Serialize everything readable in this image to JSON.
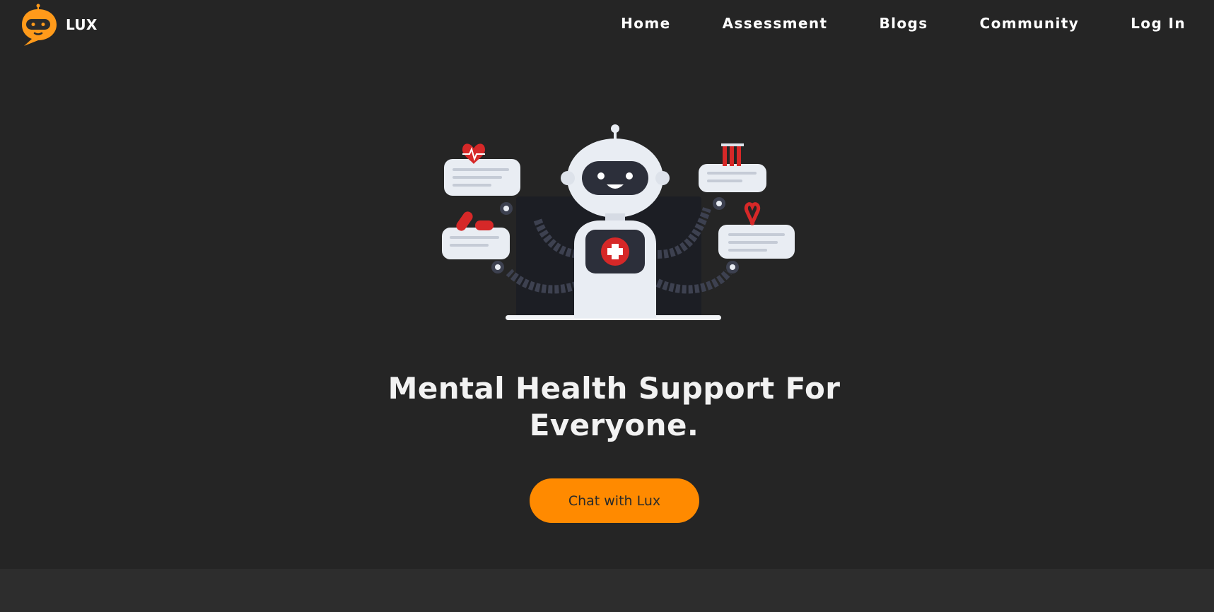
{
  "brand": {
    "name": "LUX",
    "logo_icon": "robot-chat-bubble-icon",
    "accent": "#ff8a00"
  },
  "nav": {
    "items": [
      {
        "label": "Home"
      },
      {
        "label": "Assessment"
      },
      {
        "label": "Blogs"
      },
      {
        "label": "Community"
      },
      {
        "label": "Log In"
      }
    ]
  },
  "hero": {
    "illustration": "medical-robot-icon",
    "title_line1": "Mental Health Support For",
    "title_line2": "Everyone.",
    "cta_label": "Chat with Lux"
  },
  "colors": {
    "background": "#252525",
    "footer_band": "#2d2d2d",
    "cta": "#ff8a00",
    "text": "#ffffff"
  }
}
